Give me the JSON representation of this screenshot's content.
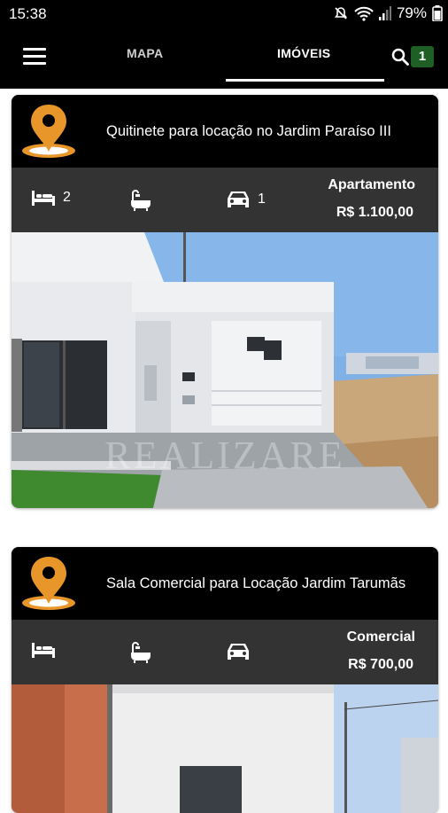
{
  "status_bar": {
    "time": "15:38",
    "battery": "79%"
  },
  "app_bar": {
    "tabs": [
      {
        "label": "MAPA"
      },
      {
        "label": "IMÓVEIS"
      }
    ],
    "result_count": "1"
  },
  "listings": [
    {
      "title": "Quitinete para locação no Jardim Paraíso III",
      "bedrooms": "2",
      "bathrooms": "",
      "parking": "1",
      "type": "Apartamento",
      "price": "R$ 1.100,00",
      "watermark": "REALIZARE"
    },
    {
      "title": "Sala Comercial para Locação Jardim Tarumãs",
      "bedrooms": "",
      "bathrooms": "",
      "parking": "",
      "type": "Comercial",
      "price": "R$ 700,00"
    }
  ],
  "colors": {
    "pin": "#e8962a",
    "info_bar": "#333333",
    "badge": "#1e5f26",
    "header": "#000000"
  }
}
